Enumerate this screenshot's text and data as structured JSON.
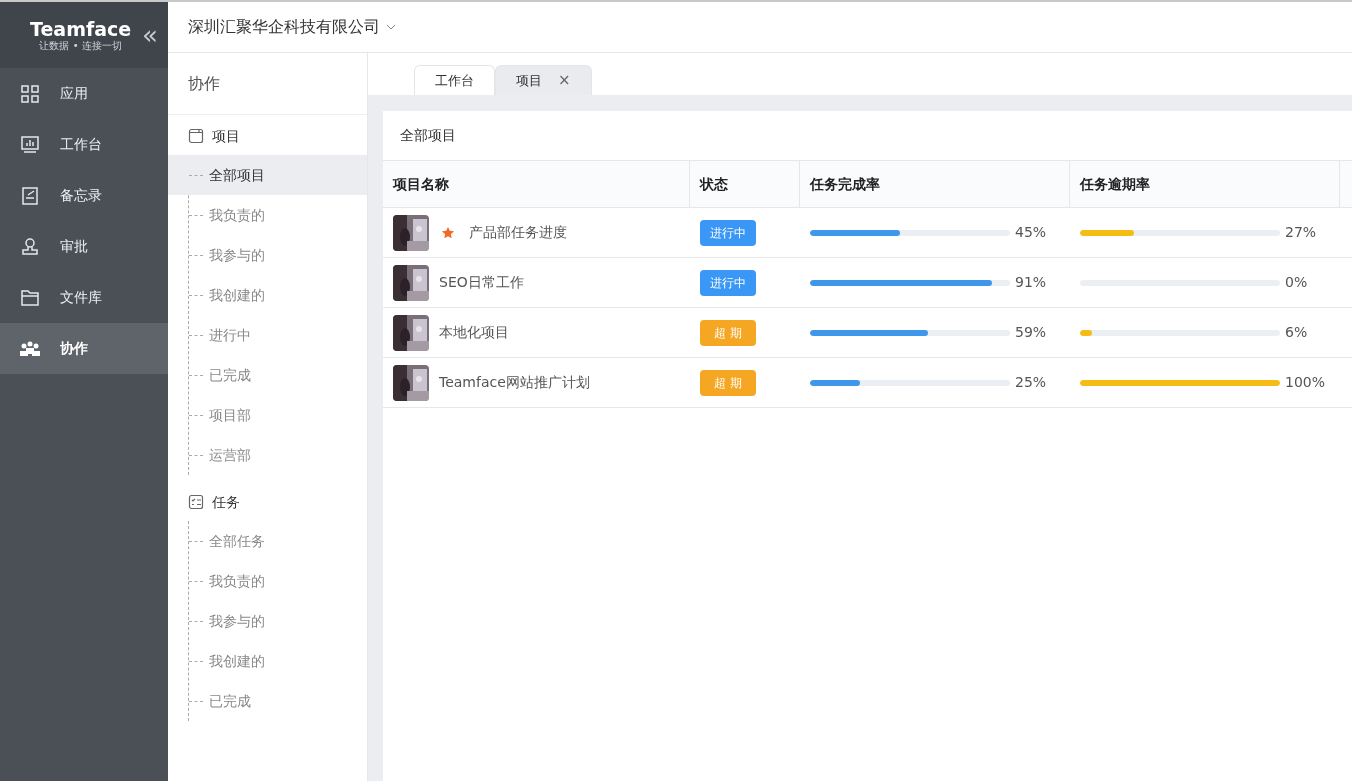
{
  "brand": {
    "name": "Teamface",
    "slogan": "让数据 • 连接一切",
    "collapse": "«"
  },
  "nav": [
    {
      "label": "应用",
      "kind": "apps",
      "selected": false
    },
    {
      "label": "工作台",
      "kind": "board",
      "selected": false
    },
    {
      "label": "备忘录",
      "kind": "memo",
      "selected": false
    },
    {
      "label": "审批",
      "kind": "stamp",
      "selected": false
    },
    {
      "label": "文件库",
      "kind": "folder",
      "selected": false
    },
    {
      "label": "协作",
      "kind": "team",
      "selected": true
    }
  ],
  "company": "深圳汇聚华企科技有限公司",
  "panel_title": "协作",
  "tree": [
    {
      "label": "项目",
      "kind": "project",
      "children": [
        {
          "label": "全部项目",
          "selected": true
        },
        {
          "label": "我负责的",
          "selected": false
        },
        {
          "label": "我参与的",
          "selected": false
        },
        {
          "label": "我创建的",
          "selected": false
        },
        {
          "label": "进行中",
          "selected": false
        },
        {
          "label": "已完成",
          "selected": false
        },
        {
          "label": "项目部",
          "selected": false
        },
        {
          "label": "运营部",
          "selected": false
        }
      ]
    },
    {
      "label": "任务",
      "kind": "task",
      "children": [
        {
          "label": "全部任务",
          "selected": false
        },
        {
          "label": "我负责的",
          "selected": false
        },
        {
          "label": "我参与的",
          "selected": false
        },
        {
          "label": "我创建的",
          "selected": false
        },
        {
          "label": "已完成",
          "selected": false
        }
      ]
    }
  ],
  "tabs": [
    {
      "label": "工作台",
      "selected": false
    },
    {
      "label": "项目",
      "selected": true,
      "close": "×"
    }
  ],
  "card_title": "全部项目",
  "table": {
    "columns": [
      "项目名称",
      "状态",
      "任务完成率",
      "任务逾期率"
    ],
    "rows": [
      {
        "name": "产品部任务进度",
        "starred": true,
        "status": "进行中",
        "color": "#3a97f6",
        "completion": {
          "level": 0.45,
          "reading": "45%"
        },
        "overdue": {
          "level": 0.27,
          "reading": "27%"
        }
      },
      {
        "name": "SEO日常工作",
        "starred": false,
        "status": "进行中",
        "color": "#3a97f6",
        "completion": {
          "level": 0.91,
          "reading": "91%"
        },
        "overdue": {
          "level": 0,
          "reading": "0%"
        }
      },
      {
        "name": "本地化项目",
        "starred": false,
        "status": "超 期",
        "color": "#f5a623",
        "completion": {
          "level": 0.59,
          "reading": "59%"
        },
        "overdue": {
          "level": 0.06,
          "reading": "6%"
        }
      },
      {
        "name": "Teamface网站推广计划",
        "starred": false,
        "status": "超 期",
        "color": "#f5a623",
        "completion": {
          "level": 0.25,
          "reading": "25%"
        },
        "overdue": {
          "level": 1,
          "reading": "100%"
        }
      }
    ]
  }
}
